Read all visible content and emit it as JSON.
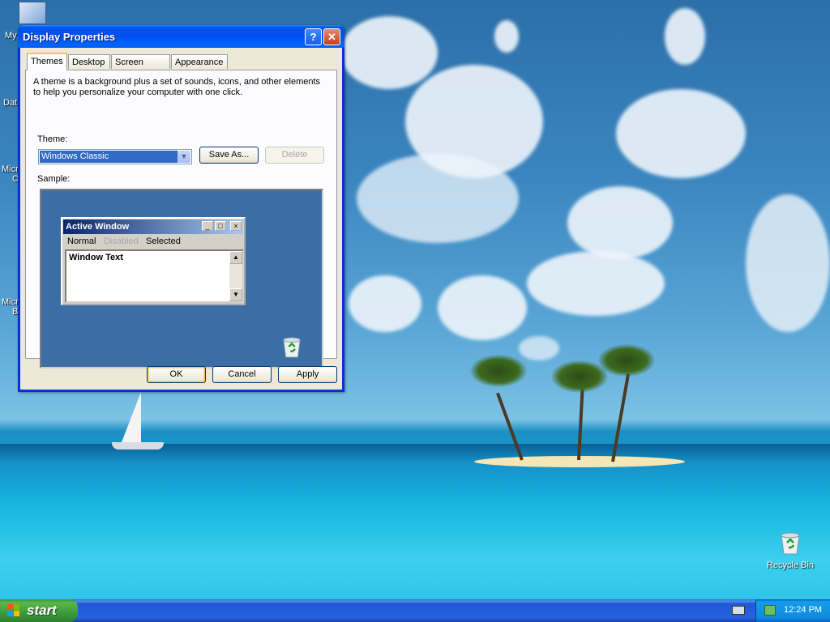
{
  "desktop": {
    "left_icon_labels": [
      "My",
      "Dat",
      "Micro",
      "C",
      "Micro",
      "B"
    ],
    "recycle_bin_label": "Recycle Bin"
  },
  "dialog": {
    "title": "Display Properties",
    "help_button": "?",
    "close_button": "✕",
    "tabs": [
      {
        "label": "Themes",
        "active": true
      },
      {
        "label": "Desktop",
        "active": false
      },
      {
        "label": "Screen Saver",
        "active": false
      },
      {
        "label": "Appearance",
        "active": false
      }
    ],
    "description": "A theme is a background plus a set of sounds, icons, and other elements to help you personalize your computer with one click.",
    "theme_label": "Theme:",
    "theme_value": "Windows Classic",
    "save_as_label": "Save As...",
    "delete_label": "Delete",
    "sample_label": "Sample:",
    "sample": {
      "window_title": "Active Window",
      "menu": [
        "Normal",
        "Disabled",
        "Selected"
      ],
      "window_text": "Window Text"
    },
    "ok_label": "OK",
    "cancel_label": "Cancel",
    "apply_label": "Apply"
  },
  "taskbar": {
    "start_label": "start",
    "clock": "12:24 PM"
  },
  "colors": {
    "taskbar_blue": "#245edb",
    "start_green": "#3c9a3c",
    "dialog_titlebar": "#0054e3",
    "classic_title": "#0a246a",
    "sample_desktop": "#3a6ea5"
  }
}
